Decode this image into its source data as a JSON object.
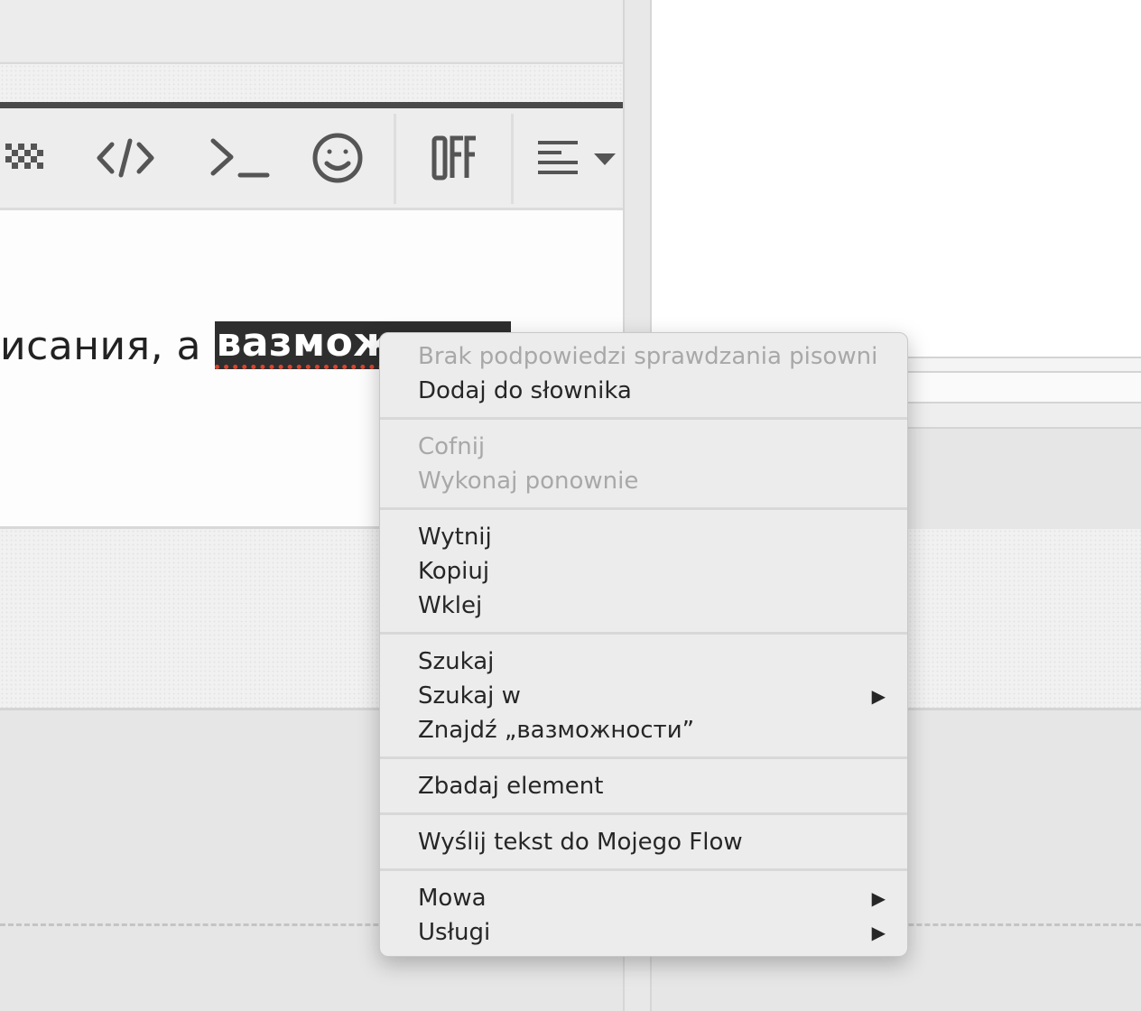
{
  "editor": {
    "text_before": "исания, а ",
    "selected_word": "вазмож"
  },
  "toolbar": {
    "buttons": [
      {
        "icon": "checkered-flag-icon"
      },
      {
        "icon": "code-icon",
        "label": "</>"
      },
      {
        "icon": "terminal-icon",
        "label": ">_"
      },
      {
        "icon": "smiley-icon"
      },
      {
        "icon": "off-icon",
        "label": "OFF"
      },
      {
        "icon": "align-left-icon"
      }
    ]
  },
  "context_menu": {
    "groups": [
      [
        {
          "label": "Brak podpowiedzi sprawdzania pisowni",
          "disabled": true
        },
        {
          "label": "Dodaj do słownika",
          "disabled": false
        }
      ],
      [
        {
          "label": "Cofnij",
          "disabled": true
        },
        {
          "label": "Wykonaj ponownie",
          "disabled": true
        }
      ],
      [
        {
          "label": "Wytnij",
          "disabled": false
        },
        {
          "label": "Kopiuj",
          "disabled": false
        },
        {
          "label": "Wklej",
          "disabled": false
        }
      ],
      [
        {
          "label": "Szukaj",
          "disabled": false
        },
        {
          "label": "Szukaj w",
          "disabled": false,
          "submenu": true
        },
        {
          "label": "Znajdź „вазможности”",
          "disabled": false
        }
      ],
      [
        {
          "label": "Zbadaj element",
          "disabled": false
        }
      ],
      [
        {
          "label": "Wyślij tekst do Mojego Flow",
          "disabled": false
        }
      ],
      [
        {
          "label": "Mowa",
          "disabled": false,
          "submenu": true
        },
        {
          "label": "Usługi",
          "disabled": false,
          "submenu": true
        }
      ]
    ],
    "submenu_arrow": "▶"
  }
}
